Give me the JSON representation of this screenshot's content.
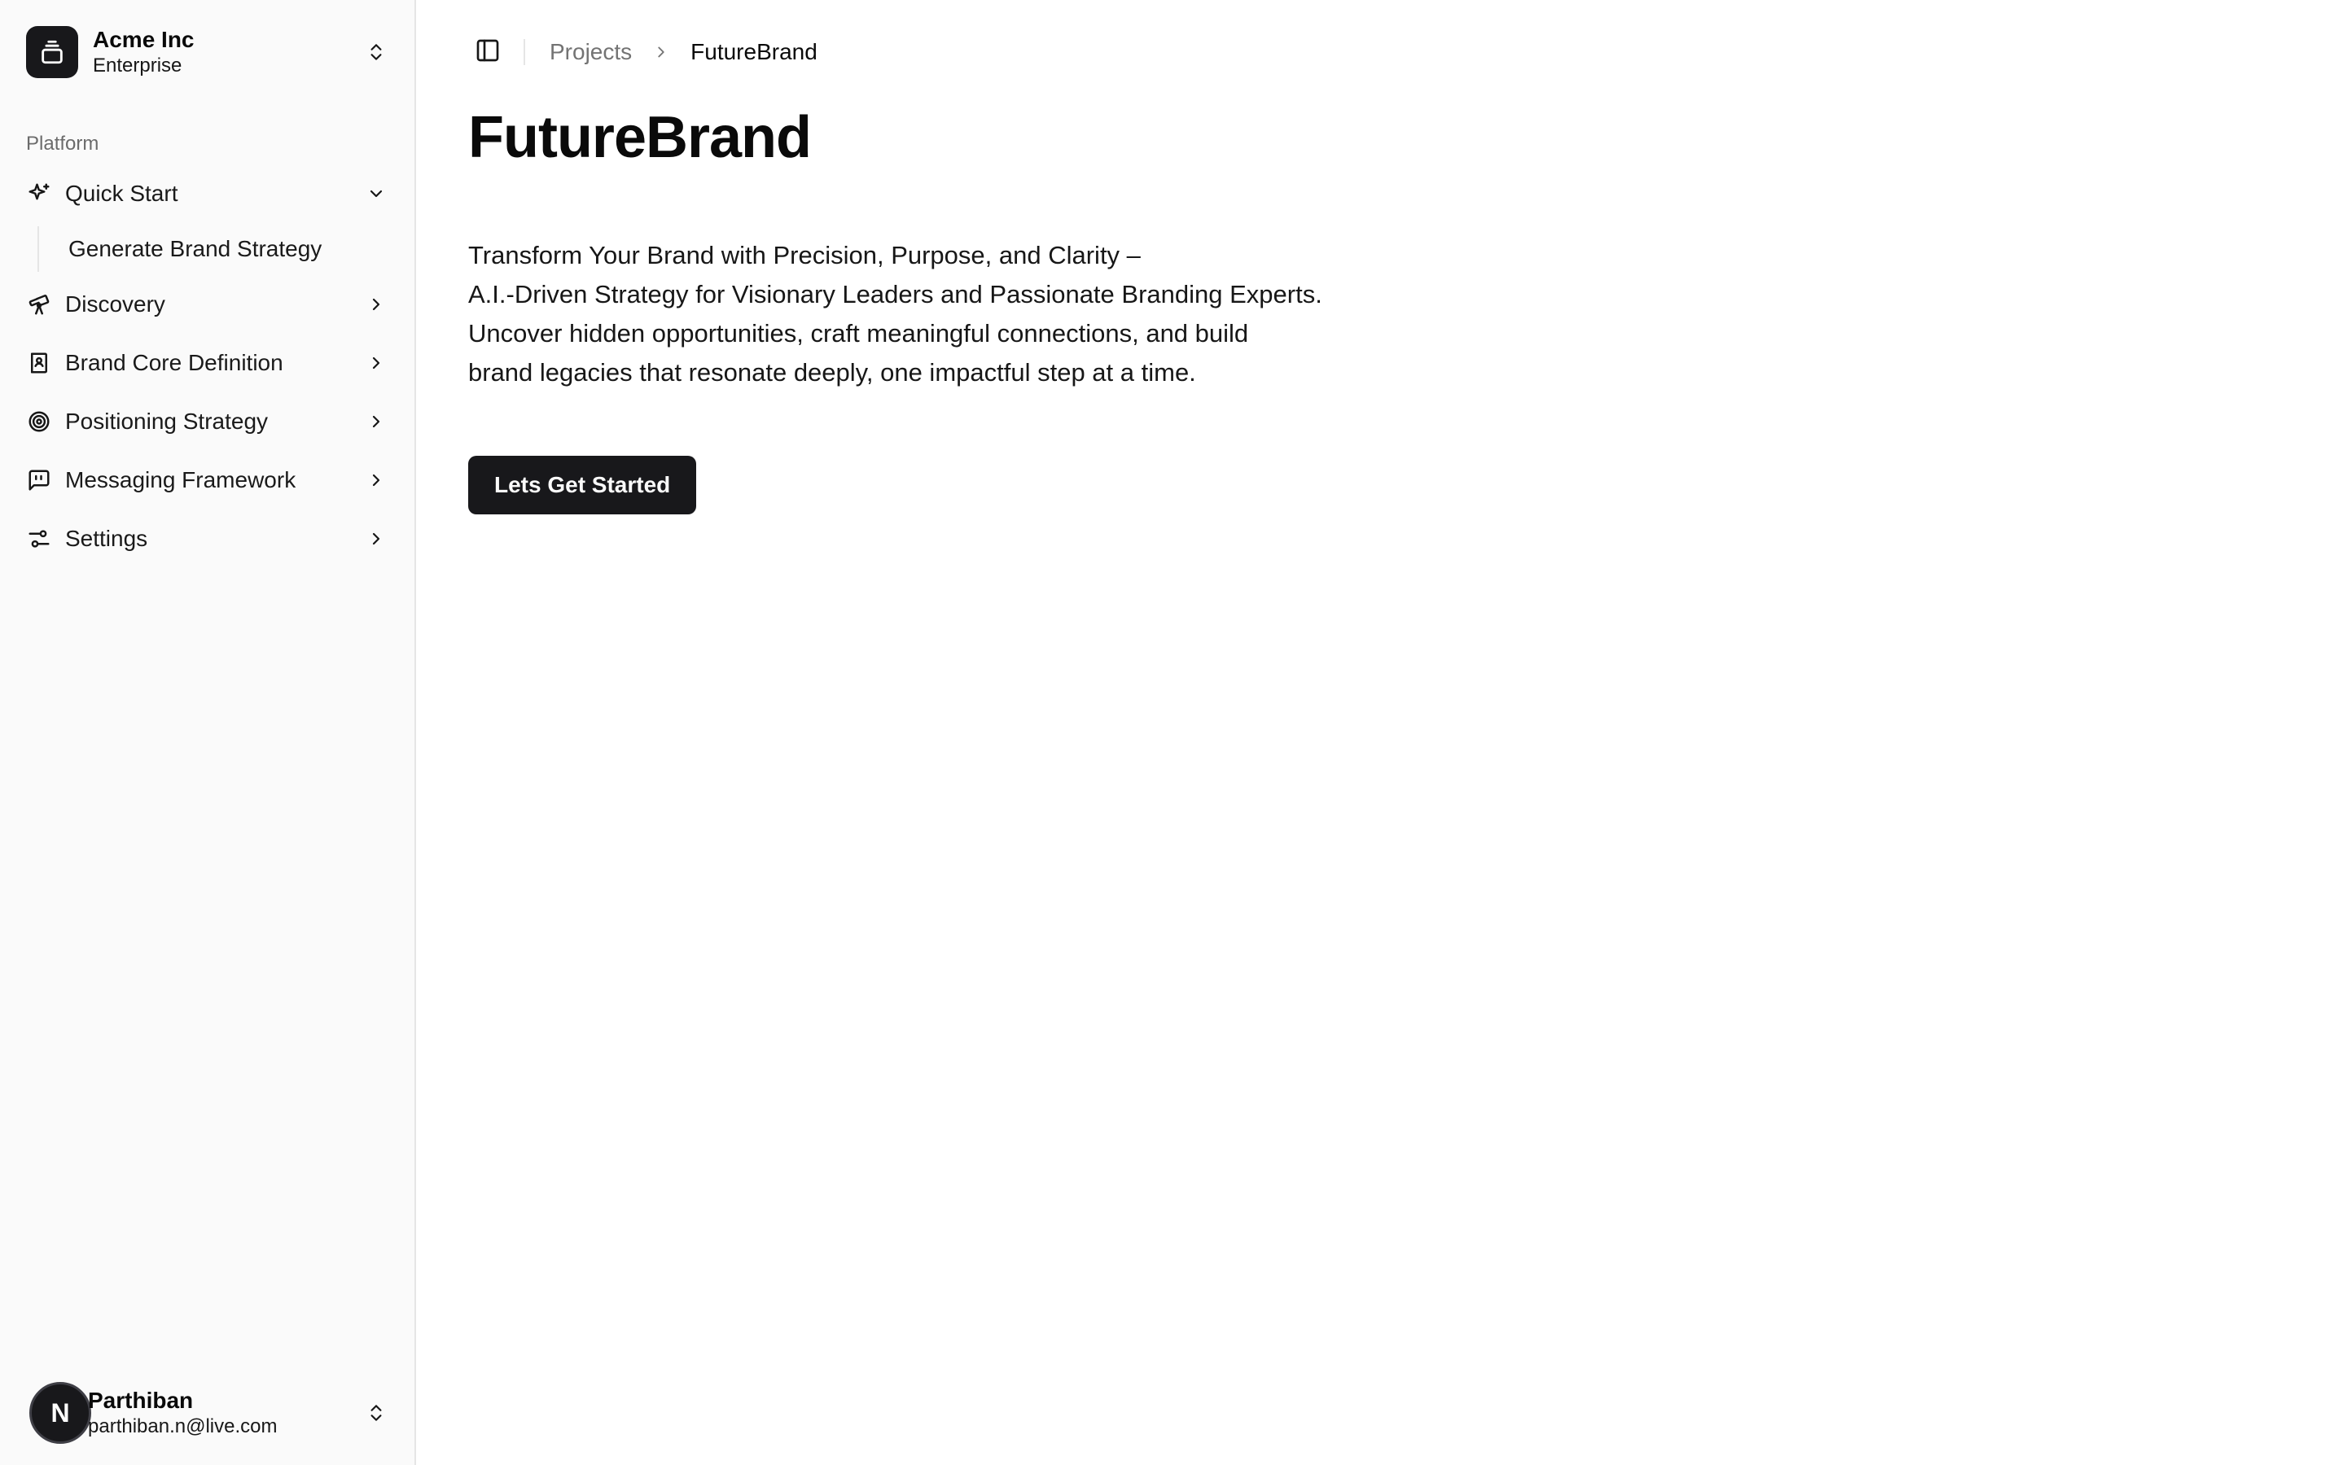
{
  "team": {
    "name": "Acme Inc",
    "plan": "Enterprise",
    "logo_icon": "gallery-stack-icon",
    "switcher_icon": "chevrons-up-down-icon"
  },
  "sidebar": {
    "group_label": "Platform",
    "items": [
      {
        "label": "Quick Start",
        "icon": "sparkles-icon",
        "expanded": true,
        "children": [
          {
            "label": "Generate Brand Strategy"
          }
        ]
      },
      {
        "label": "Discovery",
        "icon": "telescope-icon",
        "expanded": false
      },
      {
        "label": "Brand Core Definition",
        "icon": "book-user-icon",
        "expanded": false
      },
      {
        "label": "Positioning Strategy",
        "icon": "target-icon",
        "expanded": false
      },
      {
        "label": "Messaging Framework",
        "icon": "message-square-quote-icon",
        "expanded": false
      },
      {
        "label": "Settings",
        "icon": "sliders-icon",
        "expanded": false
      }
    ]
  },
  "user": {
    "initial": "N",
    "name": "Parthiban",
    "email": "parthiban.n@live.com"
  },
  "breadcrumb": {
    "parent": "Projects",
    "current": "FutureBrand"
  },
  "page": {
    "title": "FutureBrand",
    "description_lines": [
      "Transform Your Brand with Precision, Purpose, and Clarity –",
      "A.I.-Driven Strategy for Visionary Leaders and Passionate Branding Experts.",
      "Uncover hidden opportunities, craft meaningful connections, and build",
      "brand legacies that resonate deeply, one impactful step at a time."
    ],
    "cta_label": "Lets Get Started"
  },
  "colors": {
    "primary": "#18181b",
    "sidebar_bg": "#fafafa",
    "muted_text": "#737373",
    "border": "#e5e5e5"
  }
}
